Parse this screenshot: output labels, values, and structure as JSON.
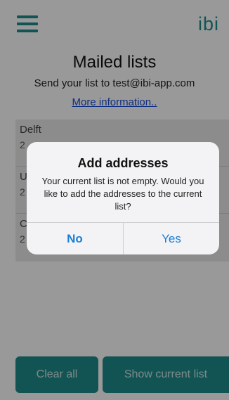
{
  "header": {
    "brand": "ibi"
  },
  "main": {
    "title": "Mailed lists",
    "subtitle": "Send your list to test@ibi-app.com",
    "info_link": "More information.."
  },
  "lists": [
    {
      "title": "Delft",
      "sub": "2"
    },
    {
      "title": "U",
      "sub": "2"
    },
    {
      "title": "C",
      "sub": "2"
    }
  ],
  "footer": {
    "clear_label": "Clear all",
    "show_label": "Show current list"
  },
  "dialog": {
    "title": "Add addresses",
    "message": "Your current list is not empty. Would you like to add the addresses to the current list?",
    "no_label": "No",
    "yes_label": "Yes"
  },
  "colors": {
    "accent": "#1e8c8c",
    "link": "#1a4fd6",
    "dialog_button": "#1a7fd6"
  },
  "icons": {
    "menu": "hamburger-menu-icon"
  }
}
